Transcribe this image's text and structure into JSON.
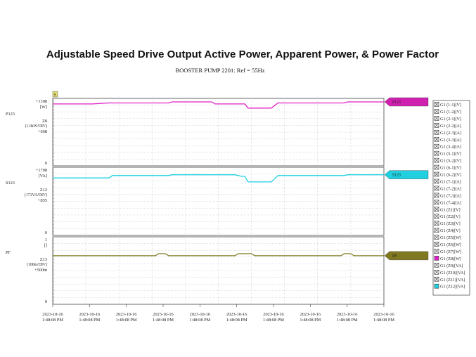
{
  "title": "Adjustable Speed Drive Output Active Power, Apparent Power, & Power Factor",
  "subtitle": "BOOSTER PUMP 2201: Ref = 55Hz",
  "cursor_label": "S",
  "colors": {
    "p": "#e020c8",
    "p_flag": "#d020b0",
    "s": "#20d0e0",
    "pf": "#807820",
    "grid": "#c8c8c8",
    "frame": "#444444"
  },
  "x_ticks": [
    {
      "date": "2023-10-16",
      "time": "1:48:08 PM"
    },
    {
      "date": "2023-10-16",
      "time": "1:48:08 PM"
    },
    {
      "date": "2023-10-16",
      "time": "1:48:08 PM"
    },
    {
      "date": "2023-10-16",
      "time": "1:48:08 PM"
    },
    {
      "date": "2023-10-16",
      "time": "1:48:08 PM"
    },
    {
      "date": "2023-10-16",
      "time": "1:48:08 PM"
    },
    {
      "date": "2023-10-16",
      "time": "1:48:08 PM"
    },
    {
      "date": "2023-10-16",
      "time": "1:48:08 PM"
    },
    {
      "date": "2023-10-16",
      "time": "1:48:08 PM"
    },
    {
      "date": "2023-10-16",
      "time": "1:48:08 PM"
    }
  ],
  "legend": [
    {
      "label": "G1 (1-1)[V]",
      "state": "x"
    },
    {
      "label": "G1 (1-2)[V]",
      "state": "x"
    },
    {
      "label": "G1 (2-1)[V]",
      "state": "x"
    },
    {
      "label": "G1 (2-2)[A]",
      "state": "x"
    },
    {
      "label": "G1 (2-3)[A]",
      "state": "x"
    },
    {
      "label": "G1 (3-3)[A]",
      "state": "x"
    },
    {
      "label": "G1 (3-4)[A]",
      "state": "x"
    },
    {
      "label": "G1 (5-1)[V]",
      "state": "x"
    },
    {
      "label": "G1 (5-2)[V]",
      "state": "x"
    },
    {
      "label": "G1 (6-1)[V]",
      "state": "x"
    },
    {
      "label": "G1 (6-2)[V]",
      "state": "x"
    },
    {
      "label": "G1 (7-1)[A]",
      "state": "x"
    },
    {
      "label": "G1 (7-2)[A]",
      "state": "x"
    },
    {
      "label": "G1 (7-3)[A]",
      "state": "x"
    },
    {
      "label": "G1 (7-4)[A]",
      "state": "x"
    },
    {
      "label": "G1 (Z1)[V]",
      "state": "x"
    },
    {
      "label": "G1 (Z2)[V]",
      "state": "x"
    },
    {
      "label": "G1 (Z3)[V]",
      "state": "x"
    },
    {
      "label": "G1 (Z4)[V]",
      "state": "x"
    },
    {
      "label": "G1 (Z5)[W]",
      "state": "x"
    },
    {
      "label": "G1 (Z6)[W]",
      "state": "x"
    },
    {
      "label": "G1 (Z7)[W]",
      "state": "x"
    },
    {
      "label": "G1 (Z8)[W]",
      "state": "magenta"
    },
    {
      "label": "G1 (Z9)[VA]",
      "state": "x"
    },
    {
      "label": "G1 (Z10)[VA]",
      "state": "x"
    },
    {
      "label": "G1 (Z11)[VA]",
      "state": "x"
    },
    {
      "label": "G1 (Z12)[VA]",
      "state": "cyan"
    }
  ],
  "chart_data": [
    {
      "type": "line",
      "name_label": "P123",
      "series": [
        {
          "name": "P123",
          "color": "#e020c8"
        }
      ],
      "ylabel_lines": [
        "Z8",
        "(1.0kW/DIV)"
      ],
      "top_label": "+1308",
      "unit_label": "[W]",
      "mid_label": "+668",
      "zero_label": "0",
      "ylim": [
        0,
        1308
      ],
      "x": [
        0,
        0.12,
        0.17,
        0.35,
        0.36,
        0.48,
        0.49,
        0.58,
        0.59,
        0.66,
        0.68,
        0.88,
        0.89,
        1.0
      ],
      "values": [
        1200,
        1200,
        1220,
        1220,
        1240,
        1240,
        1200,
        1200,
        1120,
        1120,
        1220,
        1220,
        1240,
        1240
      ],
      "flag_label": "P123"
    },
    {
      "type": "line",
      "name_label": "S123",
      "series": [
        {
          "name": "S123",
          "color": "#20d0e0"
        }
      ],
      "ylabel_lines": [
        "Z12",
        "(171VA/DIV)"
      ],
      "top_label": "+1708",
      "unit_label": "[VA]",
      "mid_label": "+855",
      "zero_label": "0",
      "ylim": [
        0,
        1708
      ],
      "x": [
        0,
        0.17,
        0.18,
        0.35,
        0.36,
        0.55,
        0.57,
        0.58,
        0.59,
        0.66,
        0.68,
        0.88,
        0.89,
        1.0
      ],
      "values": [
        1440,
        1440,
        1500,
        1500,
        1520,
        1520,
        1480,
        1480,
        1340,
        1340,
        1500,
        1500,
        1520,
        1520
      ],
      "flag_label": "S123"
    },
    {
      "type": "line",
      "name_label": "PF",
      "series": [
        {
          "name": "PF",
          "color": "#807820"
        }
      ],
      "ylabel_lines": [
        "Z13",
        "(100m/DIV)"
      ],
      "top_label": "1",
      "unit_label": "[]",
      "mid_label": "+500m",
      "zero_label": "0",
      "ylim": [
        0,
        1
      ],
      "x": [
        0,
        0.31,
        0.32,
        0.34,
        0.35,
        0.55,
        0.56,
        0.6,
        0.61,
        0.87,
        0.88,
        0.9,
        0.91,
        1.0
      ],
      "values": [
        0.72,
        0.72,
        0.75,
        0.75,
        0.72,
        0.72,
        0.75,
        0.75,
        0.72,
        0.72,
        0.75,
        0.75,
        0.72,
        0.72
      ],
      "flag_label": "PF"
    }
  ]
}
